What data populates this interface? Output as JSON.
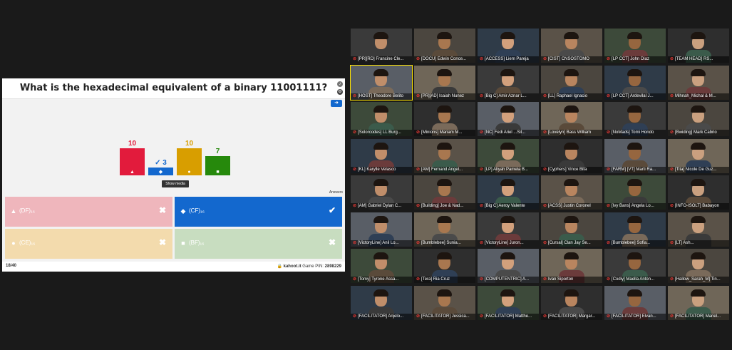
{
  "question": {
    "title": "What is the hexadecimal equivalent of a binary 11001111?",
    "skip_icon": "next-arrow-icon",
    "show_media_label": "Show media",
    "answers_label": "Answers"
  },
  "chart_data": {
    "type": "bar",
    "categories": [
      "triangle",
      "diamond",
      "circle",
      "square"
    ],
    "values": [
      10,
      3,
      10,
      7
    ],
    "value_labels": [
      "10",
      "✓ 3",
      "10",
      "7"
    ],
    "colors": [
      "#e21b3c",
      "#1368ce",
      "#d89e00",
      "#26890c"
    ],
    "symbols": [
      "▲",
      "◆",
      "●",
      "■"
    ],
    "correct_index": 1,
    "title": "",
    "xlabel": "",
    "ylabel": "",
    "ylim": [
      0,
      10
    ]
  },
  "answers": [
    {
      "shape": "▲",
      "label": "(DF)₁₆",
      "mark": "✖"
    },
    {
      "shape": "◆",
      "label": "(CF)₁₆",
      "mark": "✔"
    },
    {
      "shape": "●",
      "label": "(CE)₁₆",
      "mark": "✖"
    },
    {
      "shape": "■",
      "label": "(BF)₁₆",
      "mark": "✖"
    }
  ],
  "footer": {
    "counter": "18/40",
    "site": "kahoot.it",
    "game_pin_label": "Game PIN:",
    "game_pin": "2898229"
  },
  "colors": {
    "background": "#1a1a1a",
    "mic_muted": "#e53935",
    "active_speaker": "#ffe400"
  },
  "participants": [
    {
      "name": "[PR][RD] Francine Cle..."
    },
    {
      "name": "[DOCU] Edwin Conce..."
    },
    {
      "name": "[ACCESS] Liem Pareja"
    },
    {
      "name": "[CIST] CNSOSTOMO"
    },
    {
      "name": "[LP CCT] John Diaz"
    },
    {
      "name": "[TEAM HEAD] RS..."
    },
    {
      "name": "[HOST] Theodore Belito",
      "active": true
    },
    {
      "name": "[PR][AD] Isaiah Nunez"
    },
    {
      "name": "[Big C] Amir Aznar L..."
    },
    {
      "name": "[LL] Raphael Ignacio"
    },
    {
      "name": "[LP CCT] Ardevilal J..."
    },
    {
      "name": "Mihnah_Michal & M..."
    },
    {
      "name": "[Solorcodes] LL Burg..."
    },
    {
      "name": "[Minions] Mariam M..."
    },
    {
      "name": "[NC] Fedi Ariel ...Sil..."
    },
    {
      "name": "[Lovelyn] Bass William"
    },
    {
      "name": "[NoMads] Tomi Hondo"
    },
    {
      "name": "[Bwiding] Mark Cabrio"
    },
    {
      "name": "[KL] Karylle Velasco"
    },
    {
      "name": "[AM] Fernand Angel..."
    },
    {
      "name": "[LP] Aliyah Pamela B..."
    },
    {
      "name": "[Cyphers] Vince Bifa"
    },
    {
      "name": "[FARM] [VT] Marti Ra..."
    },
    {
      "name": "[Tita] Nicole De Guz..."
    },
    {
      "name": "[AM] Gabriel Dylan C..."
    },
    {
      "name": "[Building] Joe & Nad..."
    },
    {
      "name": "[Big C] Aeroy Valente"
    },
    {
      "name": "[ACSS] Justin Coronel"
    },
    {
      "name": "[Ivy Bans] Angela Lo..."
    },
    {
      "name": "[INFO-ISOLT] Babayon"
    },
    {
      "name": "[VictoryLine] Anil Lo..."
    },
    {
      "name": "[Bumblebee] Sunia..."
    },
    {
      "name": "[VictoryLine] Juron..."
    },
    {
      "name": "[Cursal] Clan Jay Se..."
    },
    {
      "name": "[Bumblebee] Sofia..."
    },
    {
      "name": "[LT] Ash..."
    },
    {
      "name": "[Tomy] Tyrone Assa..."
    },
    {
      "name": "[Tera] Ria Cruz"
    },
    {
      "name": "[COMPUTENTRIC] A..."
    },
    {
      "name": "Ivan Siporton"
    },
    {
      "name": "[Codiy] Maella Anton..."
    },
    {
      "name": "[Hallow_Sarah_M] Tin..."
    },
    {
      "name": "[FACILITATOR] Anjelo..."
    },
    {
      "name": "[FACILITATOR] Jessica..."
    },
    {
      "name": "[FACILITATOR] Matthe..."
    },
    {
      "name": "[FACILITATOR] Margar..."
    },
    {
      "name": "[FACILITATOR] Elvan..."
    },
    {
      "name": "[FACILITATOR] Mariel..."
    }
  ]
}
